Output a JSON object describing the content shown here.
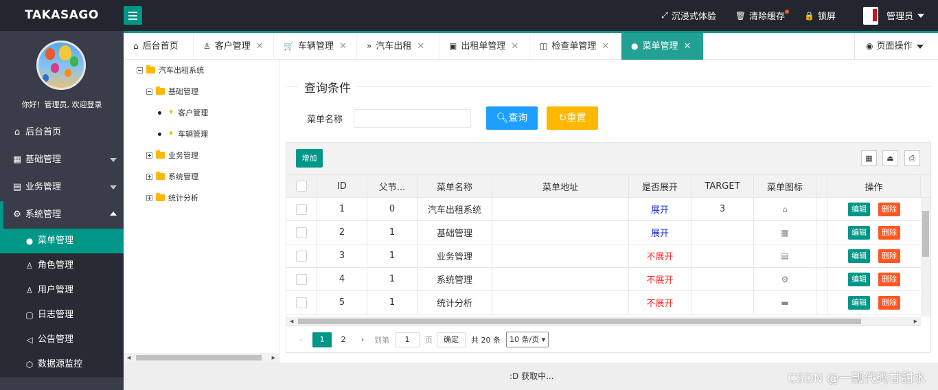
{
  "header": {
    "logo": "TAKASAGO",
    "items": [
      {
        "label": "沉浸式体验",
        "icon": "fullscreen-icon"
      },
      {
        "label": "清除缓存",
        "icon": "trash-icon"
      },
      {
        "label": "锁屏",
        "icon": "lock-icon"
      }
    ],
    "user": "管理员"
  },
  "sidebar": {
    "welcome": "你好！管理员, 欢迎登录",
    "items": [
      {
        "label": "后台首页",
        "icon": "home-icon"
      },
      {
        "label": "基础管理",
        "icon": "grid-icon"
      },
      {
        "label": "业务管理",
        "icon": "book-icon"
      },
      {
        "label": "系统管理",
        "icon": "gear-icon"
      }
    ],
    "sub_items": [
      {
        "label": "菜单管理",
        "icon": "circle-icon"
      },
      {
        "label": "角色管理",
        "icon": "user-icon"
      },
      {
        "label": "用户管理",
        "icon": "users-icon"
      },
      {
        "label": "日志管理",
        "icon": "note-icon"
      },
      {
        "label": "公告管理",
        "icon": "speaker-icon"
      },
      {
        "label": "数据源监控",
        "icon": "cube-icon"
      }
    ]
  },
  "tabs": [
    {
      "label": "后台首页",
      "icon": "home-icon"
    },
    {
      "label": "客户管理",
      "icon": "user-icon"
    },
    {
      "label": "车辆管理",
      "icon": "cart-icon"
    },
    {
      "label": "汽车出租",
      "icon": "chevrons-icon"
    },
    {
      "label": "出租单管理",
      "icon": "help-doc-icon"
    },
    {
      "label": "检查单管理",
      "icon": "read-icon"
    },
    {
      "label": "菜单管理",
      "icon": "circle-icon"
    }
  ],
  "page_op": "页面操作",
  "tree": {
    "root": "汽车出租系统",
    "children": [
      "基础管理",
      "客户管理",
      "车辆管理",
      "业务管理",
      "系统管理",
      "统计分析"
    ]
  },
  "form": {
    "legend": "查询条件",
    "label": "菜单名称",
    "query_btn": "查询",
    "reset_btn": "重置"
  },
  "table": {
    "add_btn": "增加",
    "columns": [
      "ID",
      "父节...",
      "菜单名称",
      "菜单地址",
      "是否展开",
      "TARGET",
      "菜单图标",
      "操作"
    ],
    "edit_label": "编辑",
    "delete_label": "删除",
    "rows": [
      {
        "id": "1",
        "pid": "0",
        "name": "汽车出租系统",
        "url": "",
        "spread": "展开",
        "spread_on": true,
        "target": "3",
        "icon": "home-icon"
      },
      {
        "id": "2",
        "pid": "1",
        "name": "基础管理",
        "url": "",
        "spread": "展开",
        "spread_on": true,
        "target": "",
        "icon": "grid-icon"
      },
      {
        "id": "3",
        "pid": "1",
        "name": "业务管理",
        "url": "",
        "spread": "不展开",
        "spread_on": false,
        "target": "",
        "icon": "book-icon"
      },
      {
        "id": "4",
        "pid": "1",
        "name": "系统管理",
        "url": "",
        "spread": "不展开",
        "spread_on": false,
        "target": "",
        "icon": "gear-icon"
      },
      {
        "id": "5",
        "pid": "1",
        "name": "统计分析",
        "url": "",
        "spread": "不展开",
        "spread_on": false,
        "target": "",
        "icon": "chart-icon"
      }
    ]
  },
  "pager": {
    "pages": [
      "1",
      "2"
    ],
    "goto": "到第",
    "goto_value": "1",
    "page_unit": "页",
    "confirm": "确定",
    "total": "共 20 条",
    "per_page": "10 条/页"
  },
  "footer": {
    "status": ":D 获取中...",
    "watermark": "CSDN @一瓢代码甘甜水"
  },
  "colors": {
    "primary": "#009688",
    "blue": "#1e9fff",
    "orange": "#ffb800",
    "danger": "#ff5722"
  }
}
